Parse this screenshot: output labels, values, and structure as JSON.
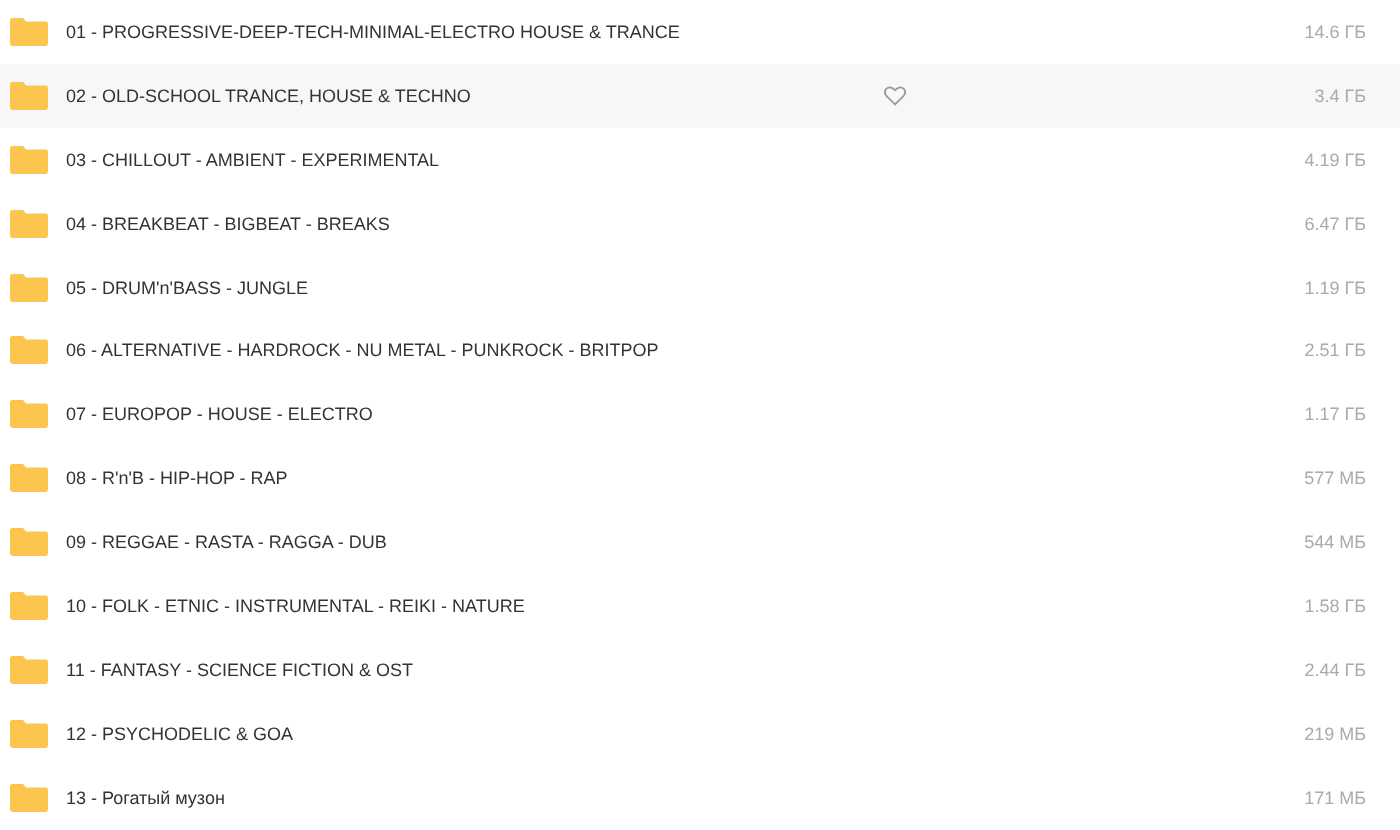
{
  "folders": [
    {
      "name": "01 - PROGRESSIVE-DEEP-TECH-MINIMAL-ELECTRO HOUSE & TRANCE",
      "size": "14.6 ГБ",
      "selected": false
    },
    {
      "name": "02 - OLD-SCHOOL TRANCE, HOUSE & TECHNO",
      "size": "3.4 ГБ",
      "selected": true
    },
    {
      "name": "03 - CHILLOUT - AMBIENT - EXPERIMENTAL",
      "size": "4.19 ГБ",
      "selected": false
    },
    {
      "name": "04 - BREAKBEAT - BIGBEAT - BREAKS",
      "size": "6.47 ГБ",
      "selected": false
    },
    {
      "name": "05 - DRUM'n'BASS - JUNGLE",
      "size": "1.19 ГБ",
      "selected": false
    },
    {
      "name": "06 - ALTERNATIVE - HARDROCK - NU METAL - PUNKROCK - BRITPOP",
      "size": "2.51 ГБ",
      "selected": false
    },
    {
      "name": "07 - EUROPOP - HOUSE - ELECTRO",
      "size": "1.17 ГБ",
      "selected": false
    },
    {
      "name": "08 - R'n'B - HIP-HOP - RAP",
      "size": "577 МБ",
      "selected": false
    },
    {
      "name": "09 - REGGAE - RASTA - RAGGA - DUB",
      "size": "544 МБ",
      "selected": false
    },
    {
      "name": "10 - FOLK - ETNIC - INSTRUMENTAL - REIKI - NATURE",
      "size": "1.58 ГБ",
      "selected": false
    },
    {
      "name": "11 - FANTASY - SCIENCE FICTION & OST",
      "size": "2.44 ГБ",
      "selected": false
    },
    {
      "name": "12 - PSYCHODELIC & GOA",
      "size": "219 МБ",
      "selected": false
    },
    {
      "name": "13 - Рогатый музон",
      "size": "171 МБ",
      "selected": false
    }
  ]
}
